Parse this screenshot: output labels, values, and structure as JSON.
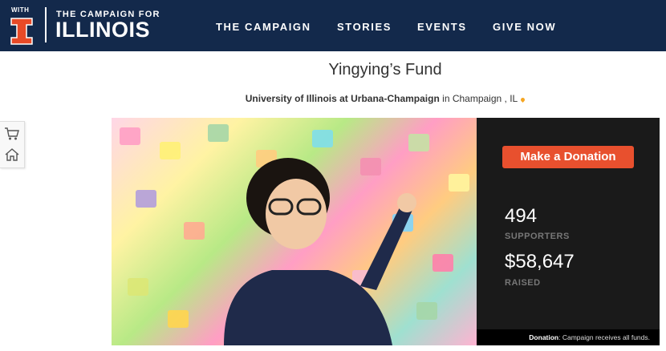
{
  "header": {
    "logo": {
      "with": "WITH",
      "tagline": "THE CAMPAIGN FOR",
      "name": "ILLINOIS"
    },
    "nav": [
      "THE CAMPAIGN",
      "STORIES",
      "EVENTS",
      "GIVE NOW"
    ]
  },
  "page": {
    "title": "Yingying’s Fund",
    "org": "University of Illinois at Urbana-Champaign",
    "loc_prefix": " in ",
    "location": "Champaign , IL"
  },
  "sidebar": {
    "icons": [
      "cart-icon",
      "home-icon"
    ]
  },
  "campaign": {
    "donate_label": "Make a Donation",
    "supporters_count": "494",
    "supporters_label": "SUPPORTERS",
    "raised_amount": "$58,647",
    "raised_label": "RAISED",
    "note_strong": "Donation",
    "note_text": ": Campaign receives all funds."
  },
  "colors": {
    "navy": "#13294b",
    "orange": "#e84a27",
    "button": "#e8502e"
  }
}
